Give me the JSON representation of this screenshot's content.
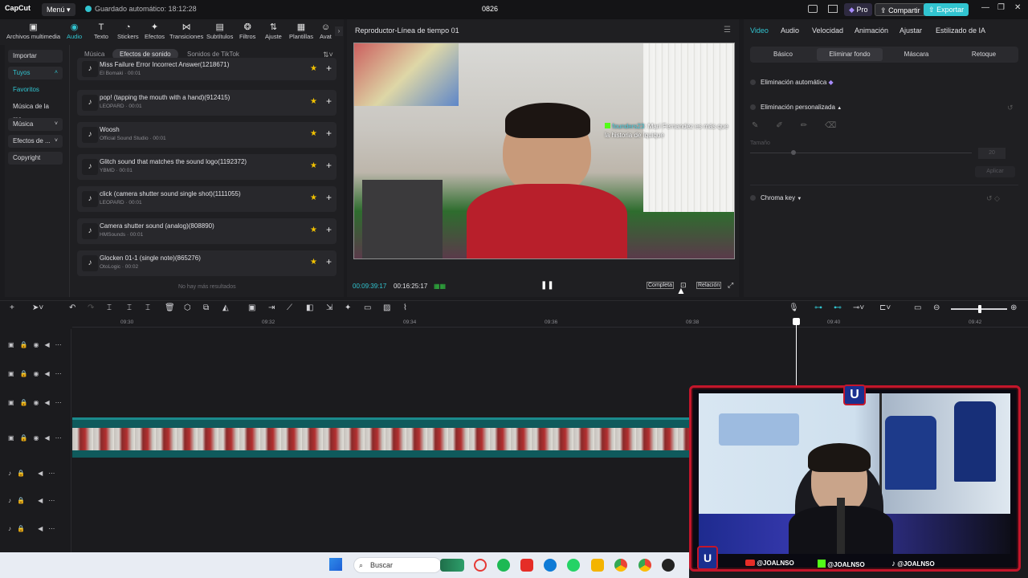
{
  "app": {
    "logo": "CapCut",
    "menu_label": "Menú",
    "autosave": "Guardado automático: 18:12:28",
    "project_name": "0826",
    "pro_label": "Pro",
    "share_label": "Compartir",
    "export_label": "Exportar"
  },
  "tooltabs": [
    {
      "label": "Archivos multimedia",
      "icon": "media-icon"
    },
    {
      "label": "Audio",
      "icon": "audio-icon"
    },
    {
      "label": "Texto",
      "icon": "text-icon"
    },
    {
      "label": "Stickers",
      "icon": "sticker-icon"
    },
    {
      "label": "Efectos",
      "icon": "effects-icon"
    },
    {
      "label": "Transiciones",
      "icon": "transition-icon"
    },
    {
      "label": "Subtítulos",
      "icon": "subtitle-icon"
    },
    {
      "label": "Filtros",
      "icon": "filter-icon"
    },
    {
      "label": "Ajuste",
      "icon": "adjust-icon"
    },
    {
      "label": "Plantillas",
      "icon": "template-icon"
    },
    {
      "label": "Avat",
      "icon": "avatar-icon"
    }
  ],
  "leftnav": {
    "import": "Importar",
    "yours": "Tuyos",
    "favorites": "Favoritos",
    "music_of": "Música de la ma...",
    "music": "Música",
    "sound_effects": "Efectos de ...",
    "copyright": "Copyright"
  },
  "subtabs": [
    "Música",
    "Efectos de sonido",
    "Sonidos de TikTok"
  ],
  "sounds": [
    {
      "title": "Miss Failure Error Incorrect Answer(1218671)",
      "meta": "El Bomaki · 00:01"
    },
    {
      "title": "pop! (tapping the mouth with a hand)(912415)",
      "meta": "LEOPARD · 00:01"
    },
    {
      "title": "Woosh",
      "meta": "Official Sound Studio · 00:01"
    },
    {
      "title": "Glitch sound that matches the sound logo(1192372)",
      "meta": "YBMD · 00:01"
    },
    {
      "title": "click (camera shutter sound single shot)(1111055)",
      "meta": "LEOPARD · 00:01"
    },
    {
      "title": "Camera shutter sound (analog)(808890)",
      "meta": "HMSounds · 00:01"
    },
    {
      "title": "Glocken 01-1 (single note)(865276)",
      "meta": "OtoLogic · 00:02"
    }
  ],
  "no_more": "No hay más resultados",
  "player": {
    "title": "Reproductor-Línea de tiempo 01",
    "current_time": "00:09:39:17",
    "total_time": "00:16:25:17",
    "complete_label": "Completa",
    "ratio_label": "Relación",
    "overlay_user": "founders23",
    "overlay_text": ": Marí Fernandez es más que la historia de Iquique"
  },
  "right": {
    "tabs": [
      "Video",
      "Audio",
      "Velocidad",
      "Animación",
      "Ajustar",
      "Estilizado de IA"
    ],
    "subtabs": [
      "Básico",
      "Eliminar fondo",
      "Máscara",
      "Retoque"
    ],
    "auto_remove": "Eliminación automática",
    "custom_remove": "Eliminación personalizada",
    "size_label": "Tamaño",
    "size_value": "20",
    "apply_label": "Aplicar",
    "chroma_key": "Chroma key"
  },
  "timeline": {
    "ticks": [
      "09:30",
      "09:32",
      "09:34",
      "09:36",
      "09:38",
      "09:40",
      "09:42"
    ]
  },
  "cam": {
    "socials": [
      {
        "icon": "youtube-icon",
        "handle": "@JOALNSO"
      },
      {
        "icon": "kick-icon",
        "handle": "@JOALNSO"
      },
      {
        "icon": "tiktok-icon",
        "handle": "@JOALNSO"
      }
    ]
  },
  "taskbar": {
    "search_label": "Buscar"
  },
  "colors": {
    "accent": "#31c4d0",
    "star": "#f2c200",
    "cam_border": "#c4162b"
  }
}
